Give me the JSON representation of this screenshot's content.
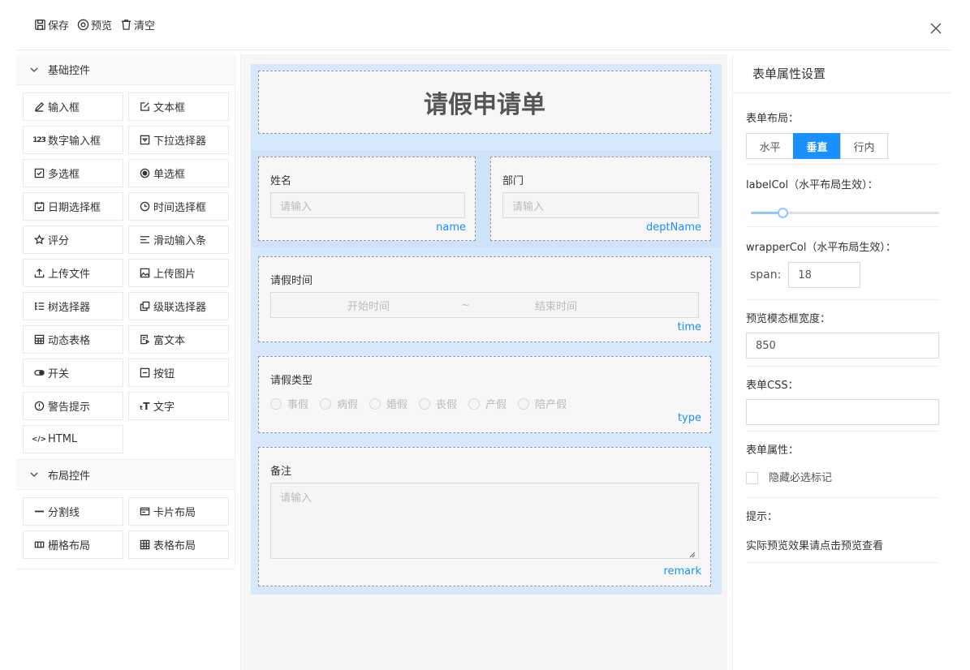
{
  "toolbar": {
    "save": "保存",
    "preview": "预览",
    "clear": "清空",
    "close": "X"
  },
  "left": {
    "basic_title": "基础控件",
    "basic_items": [
      {
        "label": "输入框",
        "icon": "pencil-icon"
      },
      {
        "label": "文本框",
        "icon": "edit-box-icon"
      },
      {
        "label": "数字输入框",
        "icon": "number-123-icon"
      },
      {
        "label": "下拉选择器",
        "icon": "dropdown-box-icon"
      },
      {
        "label": "多选框",
        "icon": "checkbox-icon"
      },
      {
        "label": "单选框",
        "icon": "radio-icon"
      },
      {
        "label": "日期选择框",
        "icon": "calendar-icon"
      },
      {
        "label": "时间选择框",
        "icon": "clock-icon"
      },
      {
        "label": "评分",
        "icon": "star-icon"
      },
      {
        "label": "滑动输入条",
        "icon": "slider-lines-icon"
      },
      {
        "label": "上传文件",
        "icon": "upload-icon"
      },
      {
        "label": "上传图片",
        "icon": "image-icon"
      },
      {
        "label": "树选择器",
        "icon": "tree-list-icon"
      },
      {
        "label": "级联选择器",
        "icon": "cascade-icon"
      },
      {
        "label": "动态表格",
        "icon": "table-icon"
      },
      {
        "label": "富文本",
        "icon": "rich-text-icon"
      },
      {
        "label": "开关",
        "icon": "switch-icon"
      },
      {
        "label": "按钮",
        "icon": "button-minus-icon"
      },
      {
        "label": "警告提示",
        "icon": "alert-icon"
      },
      {
        "label": "文字",
        "icon": "text-size-icon"
      },
      {
        "label": "HTML",
        "icon": "code-icon"
      }
    ],
    "layout_title": "布局控件",
    "layout_items": [
      {
        "label": "分割线",
        "icon": "divider-icon"
      },
      {
        "label": "卡片布局",
        "icon": "card-icon"
      },
      {
        "label": "栅格布局",
        "icon": "grid-columns-icon"
      },
      {
        "label": "表格布局",
        "icon": "table-layout-icon"
      }
    ]
  },
  "form": {
    "title": "请假申请单",
    "name_label": "姓名",
    "name_placeholder": "请输入",
    "name_key": "name",
    "dept_label": "部门",
    "dept_placeholder": "请输入",
    "dept_key": "deptName",
    "time_label": "请假时间",
    "time_start": "开始时间",
    "time_sep": "~",
    "time_end": "结束时间",
    "time_key": "time",
    "type_label": "请假类型",
    "type_options": [
      "事假",
      "病假",
      "婚假",
      "丧假",
      "产假",
      "陪产假"
    ],
    "type_key": "type",
    "remark_label": "备注",
    "remark_placeholder": "请输入",
    "remark_key": "remark"
  },
  "props": {
    "title": "表单属性设置",
    "layout_label": "表单布局：",
    "layout_options": [
      "水平",
      "垂直",
      "行内"
    ],
    "layout_selected": "垂直",
    "labelcol_label": "labelCol（水平布局生效）：",
    "labelcol_value": 4,
    "labelcol_max": 24,
    "wrappercol_label": "wrapperCol（水平布局生效）：",
    "span_label": "span:",
    "span_value": "18",
    "modal_width_label": "预览模态框宽度：",
    "modal_width_value": "850",
    "css_label": "表单CSS：",
    "css_value": "",
    "attr_label": "表单属性：",
    "hide_required": "隐藏必选标记",
    "tip_label": "提示：",
    "tip_text": "实际预览效果请点击预览查看"
  },
  "colors": {
    "accent": "#1890ff",
    "canvas_bg": "#d6e8fb"
  }
}
